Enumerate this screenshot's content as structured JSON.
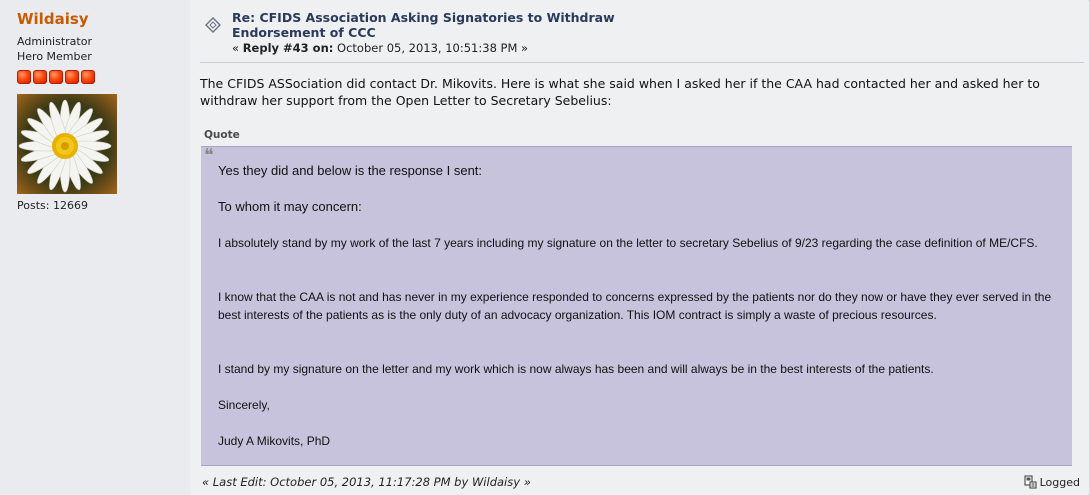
{
  "poster": {
    "name": "Wildaisy",
    "role": "Administrator",
    "rank": "Hero Member",
    "star_count": 5,
    "posts_label": "Posts: 12669"
  },
  "post": {
    "subject_line1": "Re: CFIDS Association Asking Signatories to Withdraw",
    "subject_line2": "Endorsement of CCC",
    "reply_prefix": "« ",
    "reply_label": "Reply #43 on:",
    "reply_date": " October 05, 2013, 10:51:38 PM »",
    "body": "The CFIDS ASSociation did contact Dr. Mikovits.  Here is what she said when I asked her if the CAA had contacted her and asked her to withdraw her support from the Open Letter to Secretary Sebelius:",
    "quote_header": "Quote",
    "quote_paragraphs": [
      "Yes they did and below is the response I sent:",
      "To whom it may concern:",
      "I absolutely stand by my work of the last 7 years  including my signature on the letter to secretary Sebelius of 9/23 regarding the case definition of ME/CFS.",
      "I know that the CAA  is not and has never in my experience responded to concerns expressed by the patients nor do they now or have they ever served in the best interests of the patients as is the only duty of an advocacy organization. This IOM contract is simply a waste of precious resources.",
      "I stand by my signature on the  letter and my work which is now always has been and will always be in the best interests of the patients.",
      "Sincerely,",
      "Judy A Mikovits, PhD"
    ],
    "last_edit": "« Last Edit: October 05, 2013, 11:17:28 PM by Wildaisy »",
    "logged_label": "Logged"
  },
  "colors": {
    "poster_name": "#c85a00",
    "quote_bg": "#c7c3dc",
    "star": "#ff4a12",
    "subject": "#2a3a5a"
  },
  "icons": {
    "topic": "topic-icon",
    "logged": "logged-icon",
    "quote_mark": "quote-mark-icon"
  }
}
